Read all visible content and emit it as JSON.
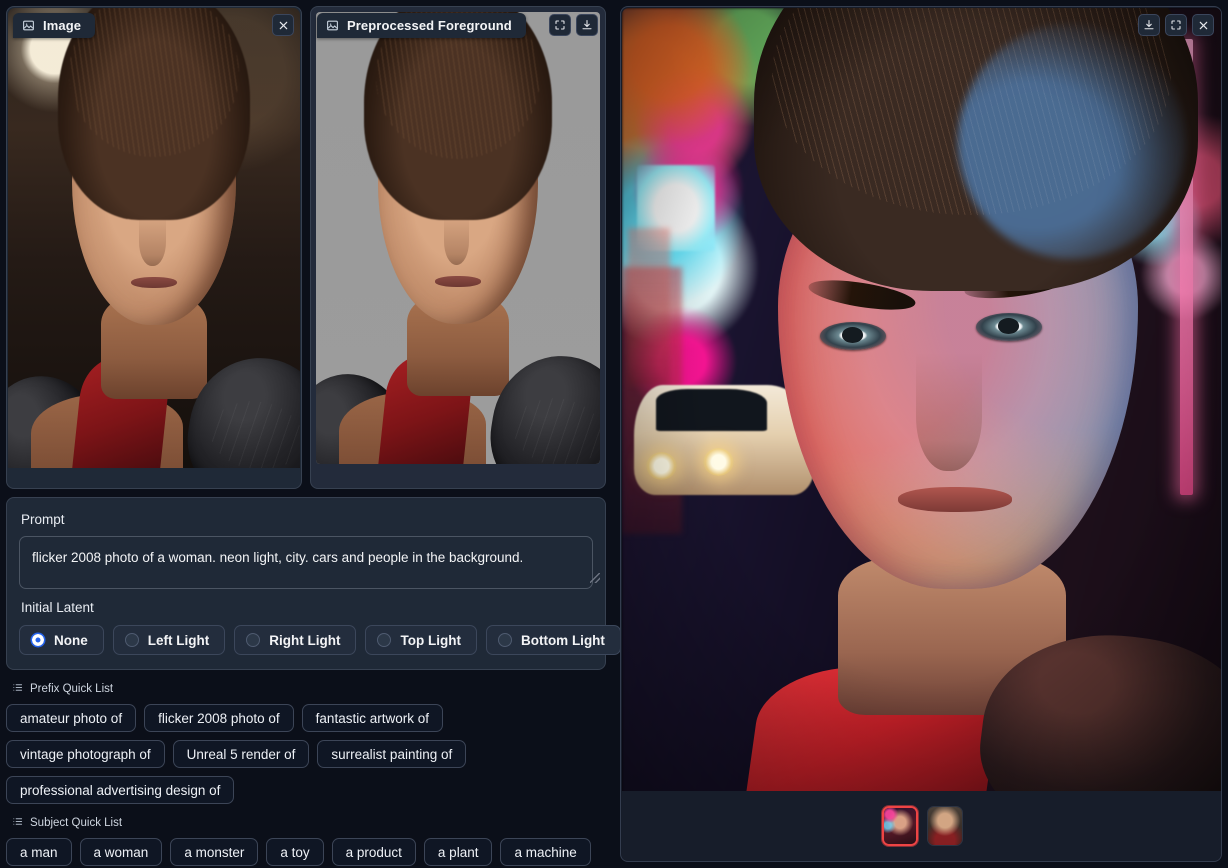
{
  "panels": {
    "input_image": {
      "tab_label": "Image",
      "tab_icon": "image-icon",
      "tools": [
        "close-icon"
      ]
    },
    "preprocessed": {
      "tab_label": "Preprocessed Foreground",
      "tab_icon": "image-icon",
      "tools": [
        "fullscreen-icon",
        "download-icon"
      ]
    },
    "result": {
      "tools": [
        "download-icon",
        "fullscreen-icon",
        "close-icon"
      ]
    }
  },
  "form": {
    "prompt_label": "Prompt",
    "prompt_value": "flicker 2008 photo of a woman. neon light, city. cars and people in the background.",
    "prompt_placeholder": "Prompt",
    "latent_label": "Initial Latent",
    "latent_options": [
      {
        "label": "None",
        "selected": true
      },
      {
        "label": "Left Light",
        "selected": false
      },
      {
        "label": "Right Light",
        "selected": false
      },
      {
        "label": "Top Light",
        "selected": false
      },
      {
        "label": "Bottom Light",
        "selected": false
      }
    ]
  },
  "prefix_quick_list": {
    "title": "Prefix Quick List",
    "icon": "list-icon",
    "items": [
      "amateur photo of",
      "flicker 2008 photo of",
      "fantastic artwork of",
      "vintage photograph of",
      "Unreal 5 render of",
      "surrealist painting of",
      "professional advertising design of"
    ]
  },
  "subject_quick_list": {
    "title": "Subject Quick List",
    "icon": "list-icon",
    "items": [
      "a man",
      "a woman",
      "a monster",
      "a toy",
      "a product",
      "a plant",
      "a machine"
    ]
  },
  "gallery": {
    "thumbnails": [
      {
        "name": "relit-neon-city-result",
        "selected": true
      },
      {
        "name": "original-boxer-portrait",
        "selected": false
      }
    ]
  },
  "colors": {
    "page_bg": "#0b0f19",
    "panel_bg": "#1f2937",
    "panel_border": "#374151",
    "accent_radio": "#2563eb",
    "selection_border": "#ef4444",
    "text": "#f3f4f6"
  }
}
